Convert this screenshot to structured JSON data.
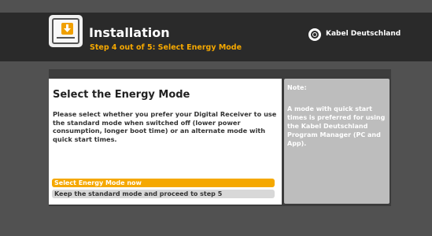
{
  "header": {
    "title": "Installation",
    "subtitle": "Step 4 out of 5: Select Energy Mode",
    "icon": "download-box-icon",
    "brand": "Kabel Deutschland",
    "accent_color": "#f5a800"
  },
  "main": {
    "title": "Select the Energy Mode",
    "body": "Please select whether you prefer your Digital Receiver to use the standard mode when switched off (lower power consumption, longer boot time) or an alternate mode with quick start times.",
    "options": [
      {
        "label": "Select Energy Mode now",
        "selected": true
      },
      {
        "label": "Keep the standard mode and proceed to step 5",
        "selected": false
      }
    ]
  },
  "note": {
    "label": "Note:",
    "body": "A mode with quick start times is preferred for using the Kabel Deutschland Program Manager (PC and App)."
  }
}
